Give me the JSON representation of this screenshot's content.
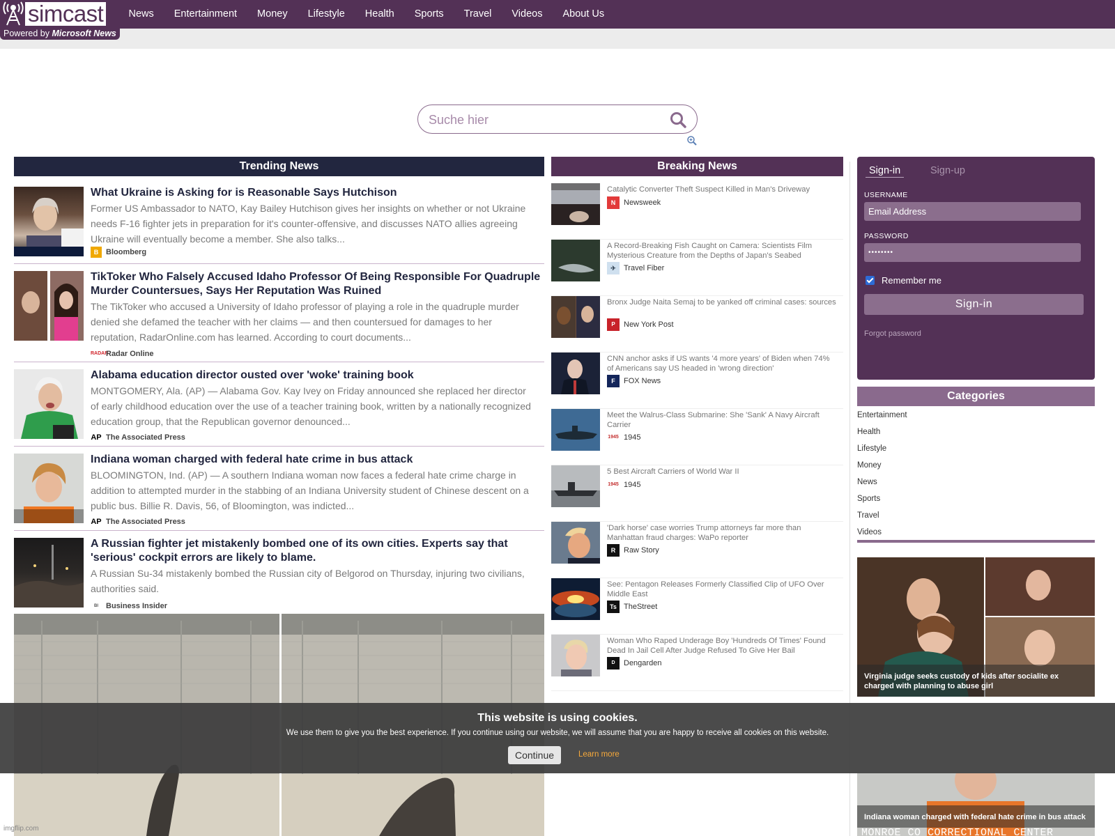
{
  "brand": {
    "name": "simcast",
    "powered_prefix": "Powered by",
    "powered_name": "Microsoft News"
  },
  "nav": [
    "News",
    "Entertainment",
    "Money",
    "Lifestyle",
    "Health",
    "Sports",
    "Travel",
    "Videos",
    "About Us"
  ],
  "search": {
    "placeholder": "Suche hier"
  },
  "trending": {
    "heading": "Trending News",
    "items": [
      {
        "title": "What Ukraine is Asking for is Reasonable Says Hutchison",
        "desc": "Former US Ambassador to NATO, Kay Bailey Hutchison gives her insights on whether or not Ukraine needs F-16 fighter jets in preparation for it's counter-offensive, and discusses NATO allies agreeing Ukraine will eventually become a member. She also talks...",
        "source": "Bloomberg"
      },
      {
        "title": "TikToker Who Falsely Accused Idaho Professor Of Being Responsible For Quadruple Murder Countersues, Says Her Reputation Was Ruined",
        "desc": "The TikToker who accused a University of Idaho professor of playing a role in the quadruple murder denied she defamed the teacher with her claims — and then countersued for damages to her reputation, RadarOnline.com has learned. According to court documents...",
        "source": "Radar Online"
      },
      {
        "title": "Alabama education director ousted over 'woke' training book",
        "desc": "MONTGOMERY, Ala. (AP) — Alabama Gov. Kay Ivey on Friday announced she replaced her director of early childhood education over the use of a teacher training book, written by a nationally recognized education group, that the Republican governor denounced...",
        "source": "The Associated Press"
      },
      {
        "title": "Indiana woman charged with federal hate crime in bus attack",
        "desc": "BLOOMINGTON, Ind. (AP) — A southern Indiana woman now faces a federal hate crime charge in addition to attempted murder in the stabbing of an Indiana University student of Chinese descent on a public bus. Billie R. Davis, 56, of Bloomington, was indicted...",
        "source": "The Associated Press"
      },
      {
        "title": "A Russian fighter jet mistakenly bombed one of its own cities. Experts say that 'serious' cockpit errors are likely to blame.",
        "desc": "A Russian Su-34 mistakenly bombed the Russian city of Belgorod on Thursday, injuring two civilians, authorities said.",
        "source": "Business Insider"
      }
    ]
  },
  "breaking": {
    "heading": "Breaking News",
    "items": [
      {
        "title": "Catalytic Converter Theft Suspect Killed in Man's Driveway",
        "source": "Newsweek"
      },
      {
        "title": "A Record-Breaking Fish Caught on Camera: Scientists Film Mysterious Creature from the Depths of Japan's Seabed",
        "source": "Travel Fiber"
      },
      {
        "title": "Bronx Judge Naita Semaj to be yanked off criminal cases: sources",
        "source": "New York Post"
      },
      {
        "title": "CNN anchor asks if US wants '4 more years' of Biden when 74% of Americans say US headed in 'wrong direction'",
        "source": "FOX News"
      },
      {
        "title": "Meet the Walrus-Class Submarine: She 'Sank' A Navy Aircraft Carrier",
        "source": "1945"
      },
      {
        "title": "5 Best Aircraft Carriers of World War II",
        "source": "1945"
      },
      {
        "title": "'Dark horse' case worries Trump attorneys far more than Manhattan fraud charges: WaPo reporter",
        "source": "Raw Story"
      },
      {
        "title": "See: Pentagon Releases Formerly Classified Clip of UFO Over Middle East",
        "source": "TheStreet"
      },
      {
        "title": "Woman Who Raped Underage Boy 'Hundreds Of Times' Found Dead In Jail Cell After Judge Refused To Give Her Bail",
        "source": "Dengarden"
      }
    ]
  },
  "signin": {
    "tab_signin": "Sign-in",
    "tab_signup": "Sign-up",
    "username_label": "USERNAME",
    "username_placeholder": "Email Address",
    "password_label": "PASSWORD",
    "password_value": "••••••••",
    "remember": "Remember me",
    "submit": "Sign-in",
    "forgot": "Forgot password"
  },
  "categories": {
    "heading": "Categories",
    "items": [
      "Entertainment",
      "Health",
      "Lifestyle",
      "Money",
      "News",
      "Sports",
      "Travel",
      "Videos"
    ]
  },
  "promos": [
    {
      "caption": "Virginia judge seeks custody of kids after socialite ex charged with planning to abuse girl"
    },
    {
      "caption": "Indiana woman charged with federal hate crime in bus attack",
      "overlay_text": "MONROE CO CORRECTIONAL CENTER"
    }
  ],
  "cookie": {
    "title": "This website is using cookies.",
    "text": "We use them to give you the best experience. If you continue using our website, we will assume that you are happy to receive all cookies on this website.",
    "continue": "Continue",
    "learn_more": "Learn more"
  },
  "watermark": "imgflip.com",
  "colors": {
    "brand": "#533156",
    "trending_header": "#22263f",
    "accent_light": "#8a6a8d",
    "cookie_link": "#f6a93b"
  }
}
